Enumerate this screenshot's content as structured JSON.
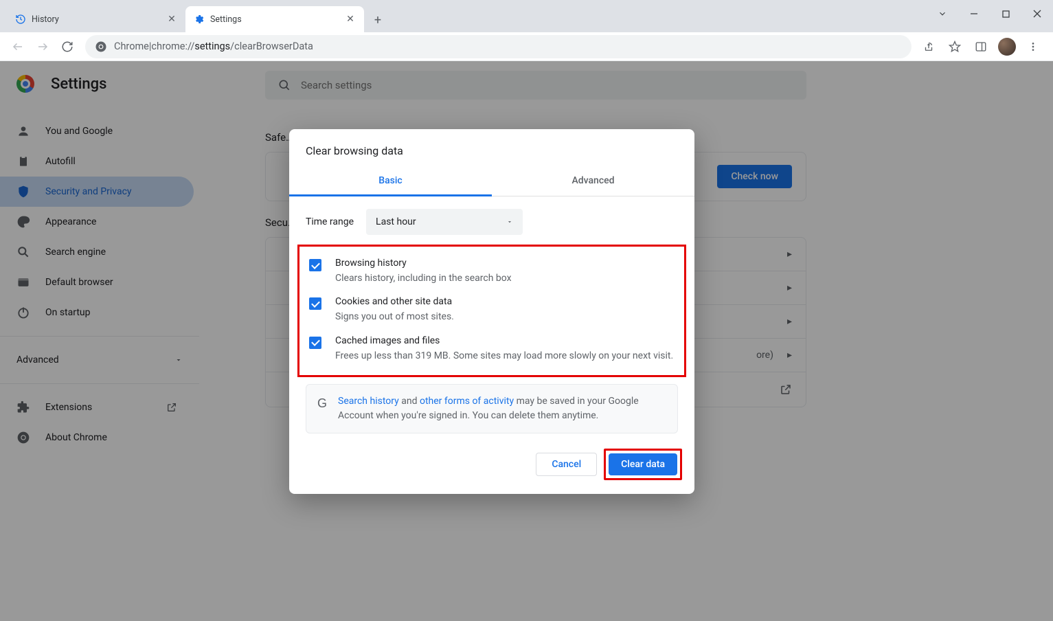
{
  "window": {
    "tabs": [
      {
        "title": "History",
        "active": false
      },
      {
        "title": "Settings",
        "active": true
      }
    ]
  },
  "omnibox": {
    "label": "Chrome",
    "separator": " | ",
    "url_prefix": "chrome://",
    "url_bold": "settings",
    "url_suffix": "/clearBrowserData"
  },
  "settings": {
    "title": "Settings",
    "search_placeholder": "Search settings",
    "sidebar": {
      "items": [
        {
          "label": "You and Google"
        },
        {
          "label": "Autofill"
        },
        {
          "label": "Security and Privacy"
        },
        {
          "label": "Appearance"
        },
        {
          "label": "Search engine"
        },
        {
          "label": "Default browser"
        },
        {
          "label": "On startup"
        }
      ],
      "advanced": "Advanced",
      "footer": [
        {
          "label": "Extensions"
        },
        {
          "label": "About Chrome"
        }
      ]
    },
    "content": {
      "section1": "Safe…",
      "check_now": "Check now",
      "section2": "Secu…",
      "more_hint": "ore)"
    }
  },
  "dialog": {
    "title": "Clear browsing data",
    "tabs": {
      "basic": "Basic",
      "advanced": "Advanced"
    },
    "time_label": "Time range",
    "time_value": "Last hour",
    "checks": [
      {
        "title": "Browsing history",
        "sub": "Clears history, including in the search box"
      },
      {
        "title": "Cookies and other site data",
        "sub": "Signs you out of most sites."
      },
      {
        "title": "Cached images and files",
        "sub": "Frees up less than 319 MB. Some sites may load more slowly on your next visit."
      }
    ],
    "info": {
      "link1": "Search history",
      "mid1": " and ",
      "link2": "other forms of activity",
      "rest": " may be saved in your Google Account when you're signed in. You can delete them anytime."
    },
    "cancel": "Cancel",
    "clear": "Clear data"
  }
}
